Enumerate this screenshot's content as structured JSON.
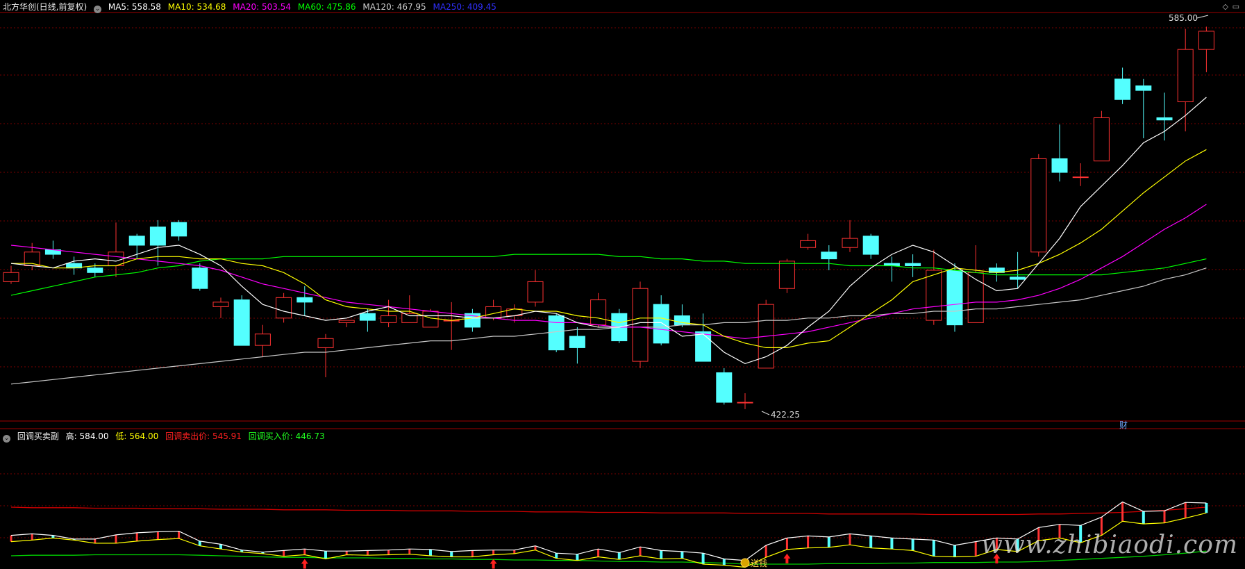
{
  "header": {
    "title": "北方华创(日线,前复权)",
    "ma5_label": "MA5:",
    "ma5_value": "558.58",
    "ma10_label": "MA10:",
    "ma10_value": "534.68",
    "ma20_label": "MA20:",
    "ma20_value": "503.54",
    "ma60_label": "MA60:",
    "ma60_value": "475.86",
    "ma120_label": "MA120:",
    "ma120_value": "467.95",
    "ma250_label": "MA250:",
    "ma250_value": "409.45"
  },
  "sub_header": {
    "title": "回调买卖副",
    "high_label": "高:",
    "high_value": "584.00",
    "low_label": "低:",
    "low_value": "564.00",
    "sell_label": "回调卖出价:",
    "sell_value": "545.91",
    "buy_label": "回调买入价:",
    "buy_value": "446.73"
  },
  "annotations": {
    "max_price": "585.00",
    "min_price": "422.25",
    "cai_marker": "财",
    "signal_label": "送钱"
  },
  "watermark": "www.zhibiaodi.com",
  "colors": {
    "up": "#ff3232",
    "down": "#54ffff",
    "ma5": "#ffffff",
    "ma10": "#ffff00",
    "ma20": "#ff00ff",
    "ma60": "#00ff00",
    "ma120": "#c8c8c8",
    "ma250": "#0000ff",
    "grid": "#7a0000"
  },
  "chart_data": [
    {
      "type": "candlestick",
      "ylim": [
        418,
        595
      ],
      "candles": [
        [
          478,
          482,
          485,
          477
        ],
        [
          485,
          491,
          495,
          483
        ],
        [
          492,
          490,
          496,
          488
        ],
        [
          486,
          484,
          489,
          481
        ],
        [
          484,
          482,
          486,
          480
        ],
        [
          485,
          491,
          504,
          480
        ],
        [
          498,
          494,
          499,
          488
        ],
        [
          502,
          494,
          505,
          485
        ],
        [
          504,
          498,
          505,
          496
        ],
        [
          484,
          475,
          486,
          474
        ],
        [
          467,
          469,
          471,
          462
        ],
        [
          470,
          450,
          472,
          450
        ],
        [
          450,
          455,
          459,
          445
        ],
        [
          462,
          471,
          473,
          460
        ],
        [
          471,
          469,
          476,
          463
        ],
        [
          449,
          453,
          455,
          436
        ],
        [
          460,
          461,
          461,
          458
        ],
        [
          464,
          461,
          466,
          456
        ],
        [
          460,
          463,
          470,
          458
        ],
        [
          460,
          464,
          472,
          460
        ],
        [
          458,
          465,
          466,
          459
        ],
        [
          461,
          461,
          469,
          448
        ],
        [
          464,
          458,
          466,
          456
        ],
        [
          462,
          467,
          470,
          461
        ],
        [
          463,
          466,
          468,
          460
        ],
        [
          469,
          478,
          483,
          467
        ],
        [
          463,
          448,
          464,
          447
        ],
        [
          454,
          449,
          458,
          442
        ],
        [
          459,
          470,
          473,
          458
        ],
        [
          464,
          452,
          466,
          451
        ],
        [
          443,
          475,
          478,
          440
        ],
        [
          468,
          451,
          472,
          450
        ],
        [
          463,
          459,
          468,
          458
        ],
        [
          456,
          443,
          464,
          443
        ],
        [
          438,
          425,
          440,
          424
        ],
        [
          425,
          425,
          429,
          422
        ],
        [
          440,
          468,
          470,
          440
        ],
        [
          475,
          487,
          488,
          473
        ],
        [
          493,
          496,
          499,
          492
        ],
        [
          491,
          488,
          494,
          483
        ],
        [
          493,
          497,
          505,
          491
        ],
        [
          498,
          490,
          499,
          488
        ],
        [
          486,
          485,
          489,
          478
        ],
        [
          486,
          485,
          490,
          480
        ],
        [
          461,
          483,
          492,
          459
        ],
        [
          483,
          459,
          486,
          456
        ],
        [
          460,
          482,
          494,
          460
        ],
        [
          484,
          482,
          486,
          478
        ],
        [
          480,
          479,
          491,
          475
        ],
        [
          491,
          532,
          534,
          489
        ],
        [
          532,
          526,
          547,
          522
        ],
        [
          524,
          524,
          530,
          520
        ],
        [
          531,
          550,
          553,
          531
        ],
        [
          567,
          558,
          572,
          556
        ],
        [
          564,
          562,
          567,
          541
        ],
        [
          550,
          549,
          561,
          540
        ],
        [
          557,
          580,
          589,
          544
        ],
        [
          580,
          588,
          590,
          570
        ]
      ],
      "ma5": [
        486,
        485,
        484,
        487,
        488,
        487,
        490,
        493,
        494,
        490,
        485,
        476,
        468,
        465,
        463,
        461,
        462,
        465,
        467,
        463,
        463,
        463,
        462,
        462,
        463,
        465,
        464,
        460,
        458,
        458,
        460,
        460,
        454,
        455,
        447,
        442,
        445,
        450,
        458,
        465,
        476,
        484,
        490,
        494,
        491,
        485,
        479,
        474,
        475,
        486,
        497,
        511,
        520,
        529,
        539,
        544,
        551,
        559
      ],
      "ma10": [
        486,
        486,
        484,
        484,
        485,
        485,
        488,
        489,
        489,
        488,
        488,
        486,
        485,
        482,
        477,
        470,
        467,
        466,
        465,
        465,
        462,
        461,
        462,
        464,
        466,
        465,
        465,
        463,
        462,
        460,
        462,
        462,
        460,
        459,
        454,
        451,
        449,
        449,
        451,
        452,
        458,
        464,
        470,
        478,
        481,
        484,
        483,
        482,
        483,
        486,
        490,
        495,
        501,
        509,
        517,
        524,
        531,
        536
      ],
      "ma20": [
        494,
        493,
        492,
        491,
        490,
        489,
        488,
        487,
        486,
        485,
        483,
        480,
        477,
        475,
        473,
        471,
        469,
        468,
        467,
        466,
        465,
        464,
        463,
        462,
        461,
        461,
        460,
        460,
        459,
        458,
        458,
        457,
        456,
        455,
        454,
        453,
        454,
        455,
        456,
        458,
        460,
        462,
        464,
        466,
        467,
        468,
        469,
        469,
        470,
        472,
        475,
        479,
        484,
        489,
        495,
        501,
        506,
        512
      ],
      "ma60": [
        472,
        474,
        476,
        478,
        480,
        481,
        482,
        484,
        485,
        487,
        488,
        488,
        488,
        489,
        489,
        489,
        489,
        489,
        489,
        489,
        489,
        489,
        489,
        489,
        490,
        490,
        490,
        490,
        490,
        489,
        489,
        488,
        488,
        487,
        487,
        486,
        486,
        486,
        486,
        486,
        485,
        485,
        485,
        484,
        484,
        483,
        482,
        481,
        481,
        481,
        481,
        481,
        481,
        482,
        483,
        484,
        486,
        488
      ],
      "ma120": [
        433,
        434,
        435,
        436,
        437,
        438,
        439,
        440,
        441,
        442,
        443,
        444,
        445,
        446,
        447,
        447,
        448,
        449,
        450,
        451,
        452,
        452,
        453,
        454,
        454,
        455,
        456,
        457,
        457,
        458,
        458,
        458,
        459,
        459,
        460,
        460,
        461,
        461,
        462,
        462,
        463,
        463,
        464,
        464,
        465,
        465,
        466,
        466,
        467,
        468,
        469,
        470,
        472,
        474,
        476,
        479,
        481,
        484
      ]
    },
    {
      "type": "line",
      "ylim": [
        366,
        596
      ],
      "high": [
        425,
        428,
        425,
        418,
        418,
        426,
        430,
        432,
        433,
        414,
        408,
        397,
        393,
        396,
        399,
        395,
        395,
        396,
        397,
        399,
        398,
        394,
        396,
        397,
        397,
        405,
        391,
        389,
        399,
        392,
        403,
        396,
        394,
        391,
        380,
        377,
        406,
        420,
        424,
        422,
        428,
        424,
        420,
        418,
        416,
        406,
        413,
        420,
        418,
        440,
        446,
        444,
        460,
        489,
        471,
        472,
        488,
        487
      ],
      "low": [
        413,
        416,
        420,
        416,
        410,
        410,
        414,
        417,
        419,
        405,
        399,
        393,
        390,
        385,
        388,
        380,
        388,
        387,
        388,
        389,
        386,
        384,
        384,
        388,
        390,
        397,
        381,
        377,
        384,
        379,
        386,
        380,
        381,
        370,
        368,
        364,
        383,
        398,
        401,
        402,
        407,
        401,
        399,
        396,
        385,
        384,
        385,
        398,
        394,
        415,
        420,
        411,
        425,
        452,
        447,
        449,
        458,
        468
      ],
      "sell": [
        479,
        478,
        478,
        478,
        477,
        477,
        477,
        476,
        476,
        476,
        475,
        475,
        475,
        474,
        474,
        474,
        473,
        473,
        473,
        472,
        472,
        472,
        471,
        471,
        471,
        470,
        470,
        470,
        469,
        469,
        469,
        468,
        468,
        468,
        468,
        467,
        467,
        467,
        467,
        466,
        466,
        466,
        466,
        466,
        465,
        465,
        465,
        465,
        465,
        466,
        466,
        467,
        468,
        469,
        471,
        473,
        476,
        479
      ],
      "buy": [
        386,
        387,
        387,
        387,
        388,
        388,
        388,
        388,
        388,
        387,
        386,
        385,
        384,
        383,
        383,
        382,
        382,
        382,
        381,
        381,
        380,
        380,
        379,
        379,
        378,
        378,
        377,
        377,
        376,
        375,
        375,
        374,
        374,
        373,
        372,
        370,
        370,
        370,
        370,
        371,
        371,
        371,
        372,
        372,
        373,
        373,
        373,
        374,
        374,
        375,
        377,
        379,
        381,
        383,
        385,
        388,
        391,
        395
      ],
      "signals": [
        {
          "index": 14,
          "kind": "buy-arrow"
        },
        {
          "index": 23,
          "kind": "buy-arrow"
        },
        {
          "index": 37,
          "kind": "buy-arrow"
        },
        {
          "index": 47,
          "kind": "buy-arrow"
        },
        {
          "index": 35,
          "kind": "coin"
        }
      ]
    }
  ]
}
